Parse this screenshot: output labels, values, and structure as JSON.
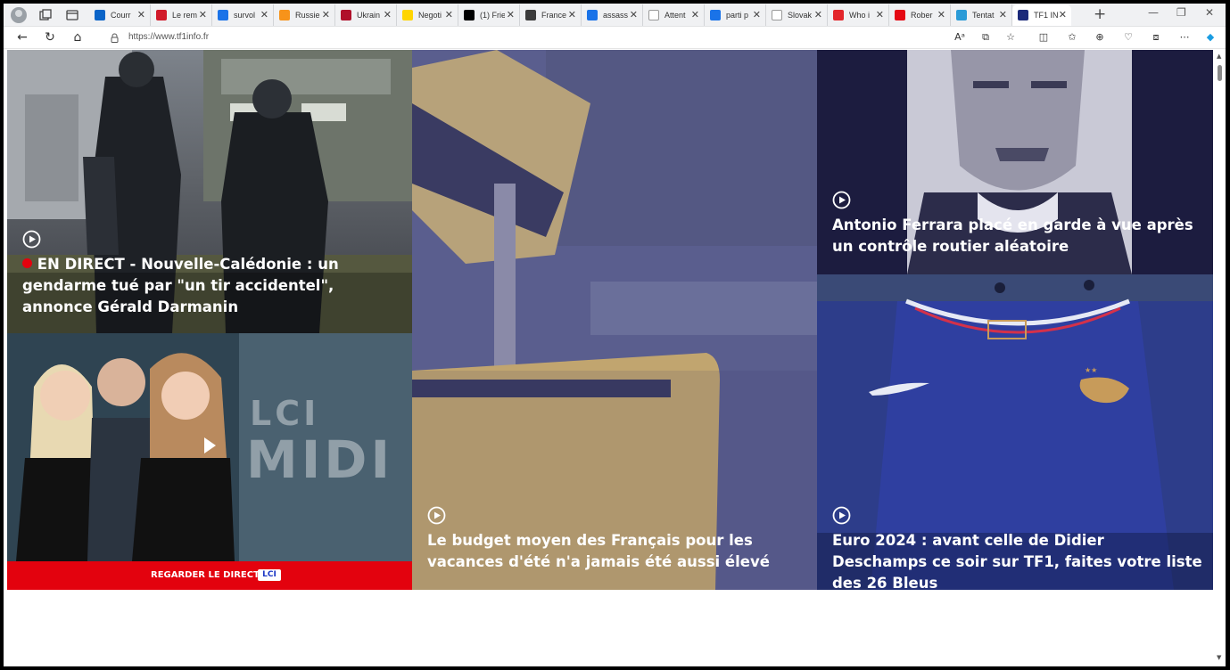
{
  "browser": {
    "tabs": [
      {
        "title": "Courr",
        "favicon": "outlook-icon",
        "color": "#0a64c8"
      },
      {
        "title": "Le rem",
        "favicon": "letter-a-icon",
        "color": "#d11a2a"
      },
      {
        "title": "survol",
        "favicon": "search-icon",
        "color": "#1a73e8"
      },
      {
        "title": "Russie",
        "favicon": "bitcoin-icon",
        "color": "#f7931a"
      },
      {
        "title": "Ukrain",
        "favicon": "news-icon",
        "color": "#b0102a"
      },
      {
        "title": "Negoti",
        "favicon": "ukraine-flag-icon",
        "color": "#ffd500"
      },
      {
        "title": "(1) Frie",
        "favicon": "x-icon",
        "color": "#000000"
      },
      {
        "title": "France",
        "favicon": "book-icon",
        "color": "#3b3b3b"
      },
      {
        "title": "assass",
        "favicon": "search-icon",
        "color": "#1a73e8"
      },
      {
        "title": "Attent",
        "favicon": "wikipedia-icon",
        "color": "#ffffff"
      },
      {
        "title": "parti p",
        "favicon": "search-icon",
        "color": "#1a73e8"
      },
      {
        "title": "Slovak",
        "favicon": "wikipedia-icon",
        "color": "#ffffff"
      },
      {
        "title": "Who i",
        "favicon": "letter-s-icon",
        "color": "#e3262b"
      },
      {
        "title": "Rober",
        "favicon": "letter-n-icon",
        "color": "#e50914"
      },
      {
        "title": "Tentat",
        "favicon": "image-icon",
        "color": "#2b9bd7"
      },
      {
        "title": "TF1 IN",
        "favicon": "tf1-icon",
        "color": "#1c2a7a",
        "active": true
      }
    ],
    "url": "https://www.tf1info.fr"
  },
  "articles": [
    {
      "title_live": "EN DIRECT",
      "title": " - Nouvelle-Calédonie : un gendarme tué par \"un tir accidentel\", annonce Gérald Darmanin"
    },
    {
      "title": "Antonio Ferrara placé en garde à vue après un contrôle routier aléatoire"
    },
    {
      "title": "Le budget moyen des Français pour les vacances d'été n'a jamais été aussi élevé"
    },
    {
      "title": "Euro 2024 : avant celle de Didier Deschamps ce soir sur TF1, faites votre liste des 26 Bleus"
    }
  ],
  "live": {
    "show_logo_lci": "LCI",
    "show_logo_midi": "MIDI",
    "banner_label": "REGARDER LE DIRECT",
    "channel": "LCI"
  },
  "colors": {
    "live_red": "#e3020e",
    "overlay_navy": "#1c1c3f"
  }
}
